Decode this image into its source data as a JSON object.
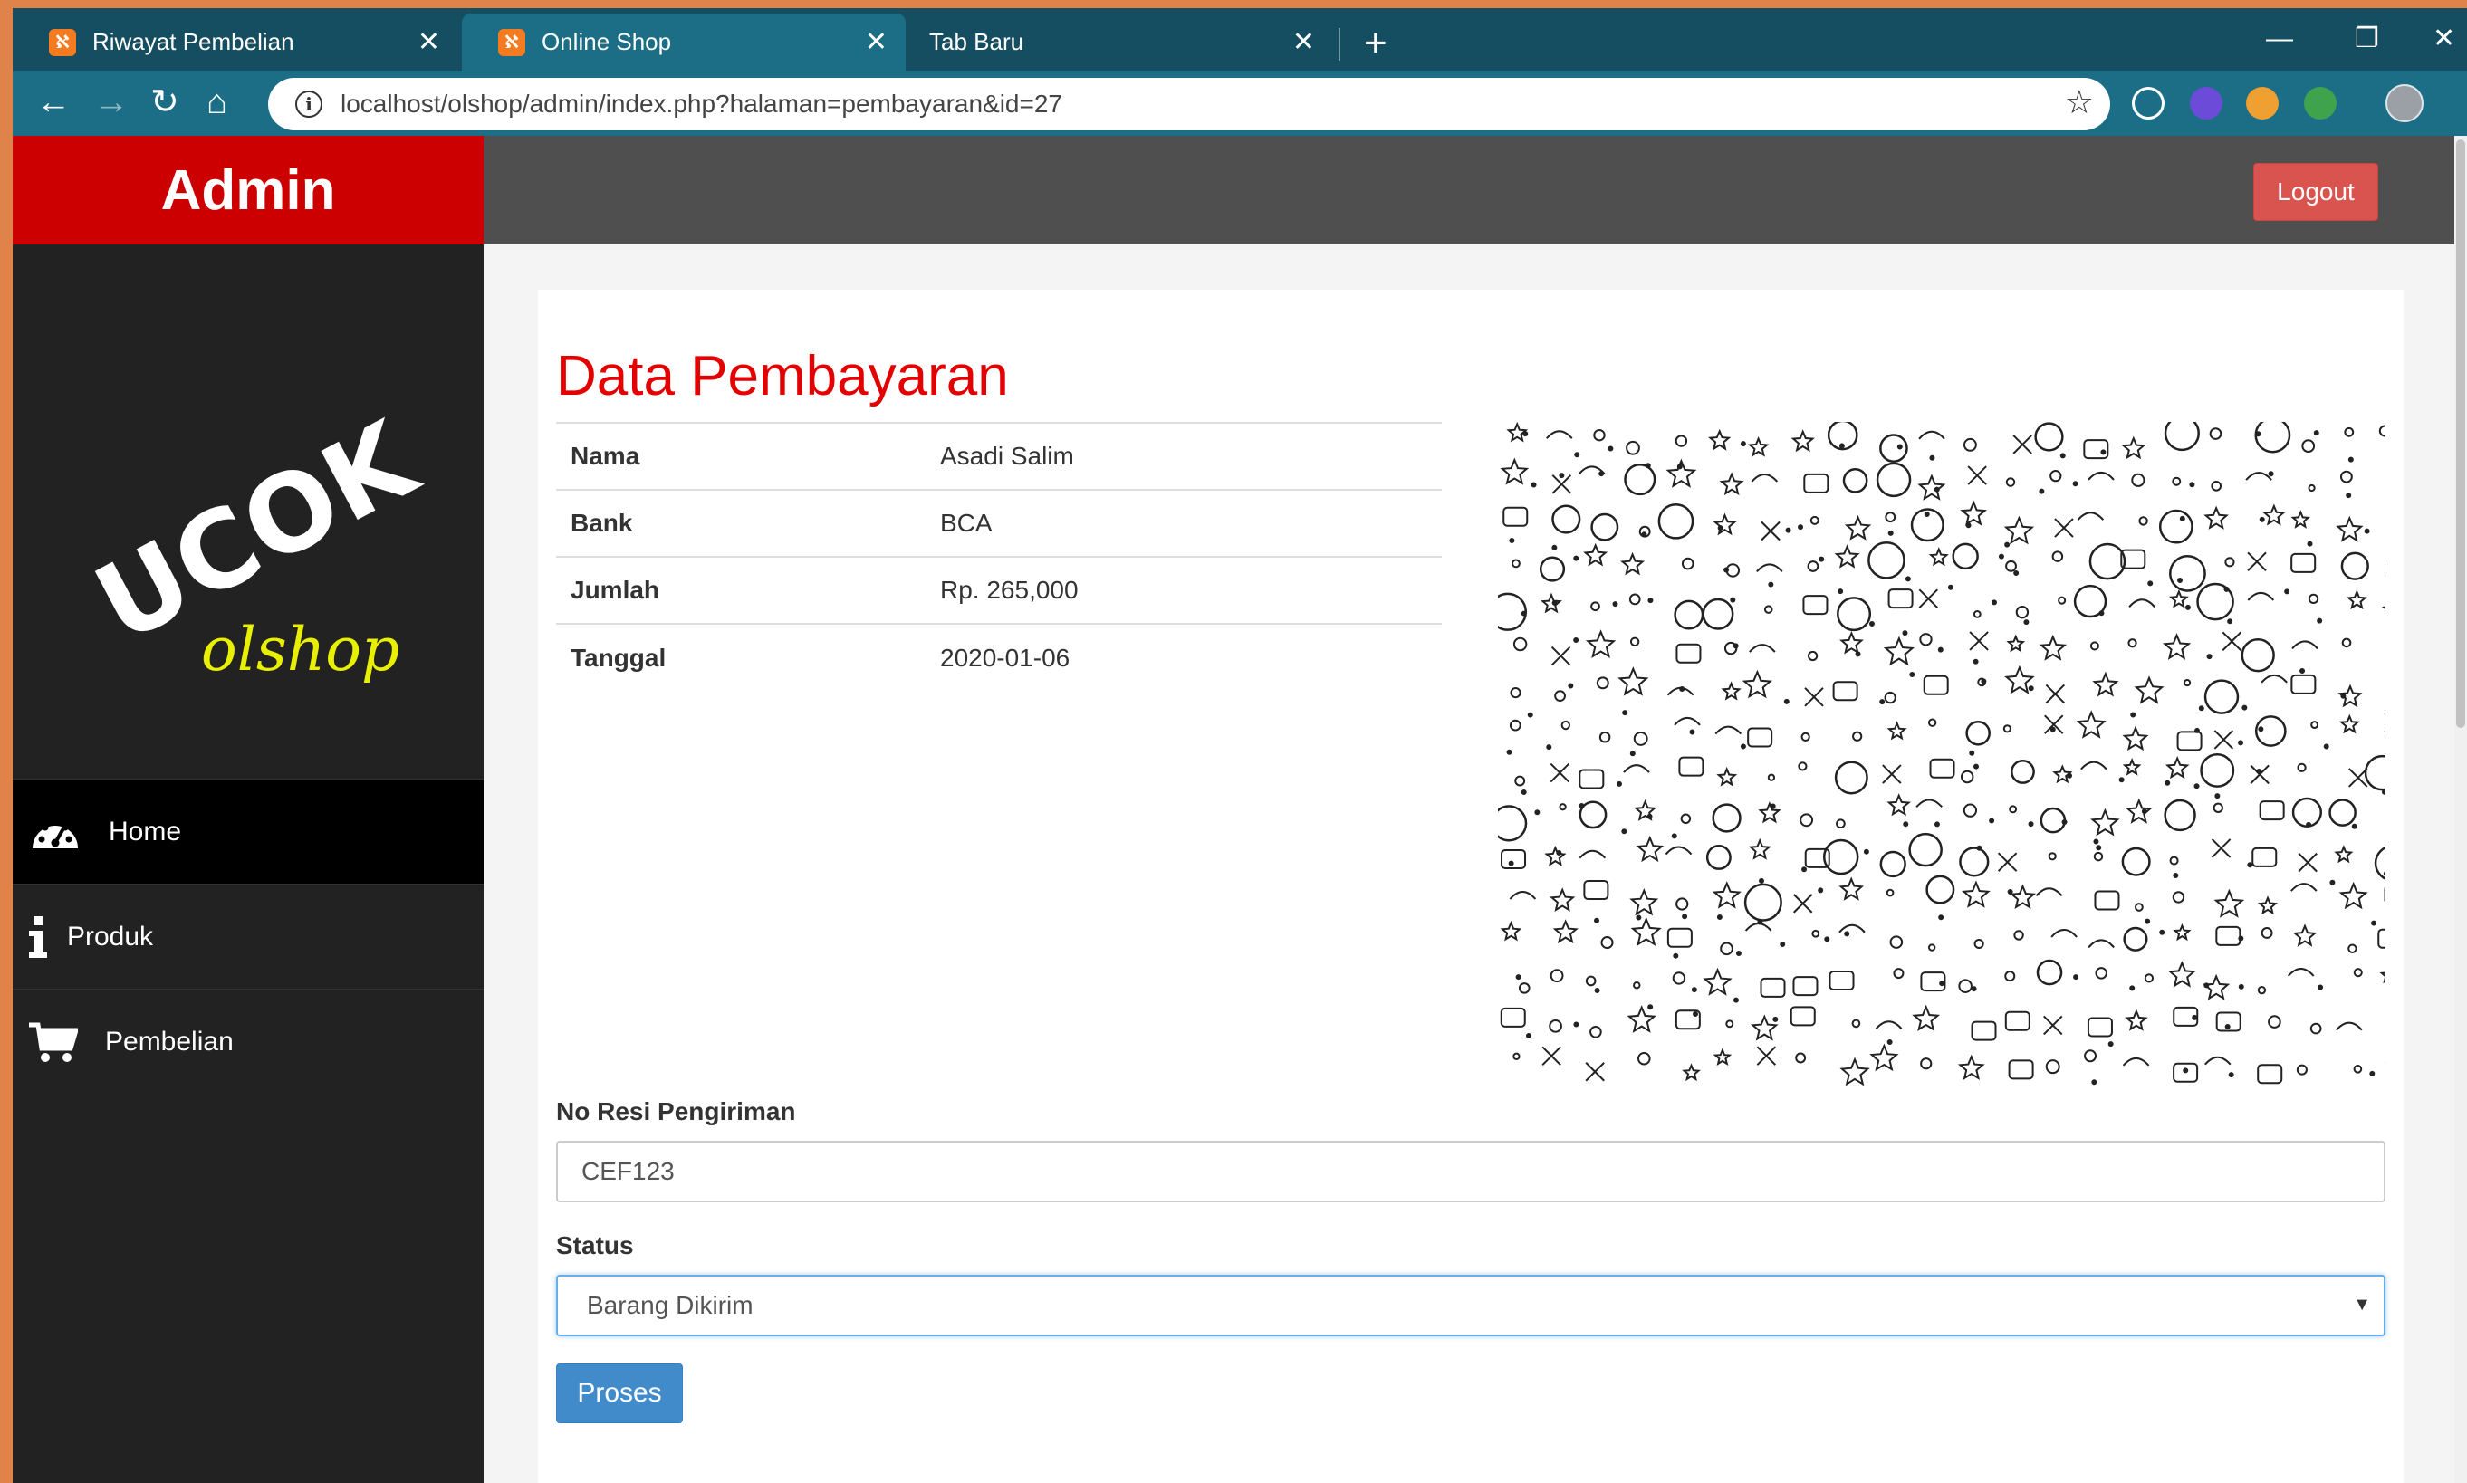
{
  "browser": {
    "tabs": [
      {
        "label": "Riwayat Pembelian",
        "active": false
      },
      {
        "label": "Online Shop",
        "active": true
      },
      {
        "label": "Tab Baru",
        "active": false
      }
    ],
    "url": "localhost/olshop/admin/index.php?halaman=pembayaran&id=27",
    "accent_color": "#1c6e86",
    "tabbar_color": "#154e60"
  },
  "header": {
    "brand": "Admin",
    "logout_label": "Logout",
    "brand_color": "#cc0000"
  },
  "logo": {
    "line1": "UCOK",
    "line2": "olshop"
  },
  "sidebar": {
    "items": [
      {
        "label": "Home",
        "icon": "dashboard-icon",
        "active": true
      },
      {
        "label": "Produk",
        "icon": "info-icon",
        "active": false
      },
      {
        "label": "Pembelian",
        "icon": "cart-icon",
        "active": false
      }
    ]
  },
  "main": {
    "title": "Data Pembayaran",
    "details": [
      {
        "key": "Nama",
        "value": "Asadi Salim"
      },
      {
        "key": "Bank",
        "value": "BCA"
      },
      {
        "key": "Jumlah",
        "value": "Rp. 265,000"
      },
      {
        "key": "Tanggal",
        "value": "2020-01-06"
      }
    ],
    "resi_label": "No Resi Pengiriman",
    "resi_value": "CEF123",
    "status_label": "Status",
    "status_value": "Barang Dikirim",
    "submit_label": "Proses"
  }
}
